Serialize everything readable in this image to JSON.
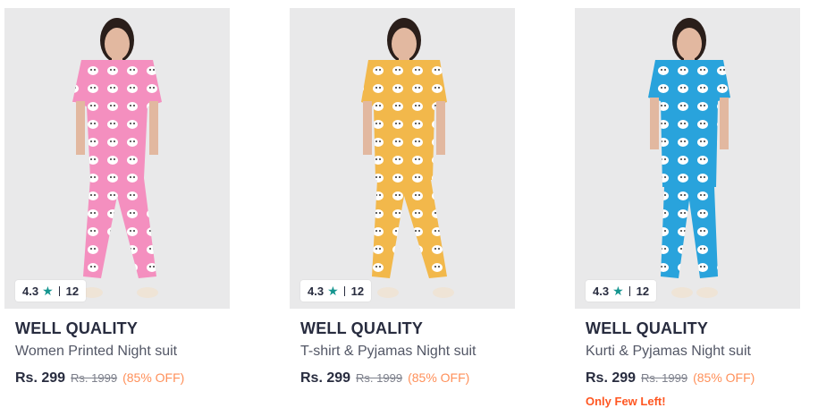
{
  "products": [
    {
      "rating": "4.3",
      "rating_count": "12",
      "brand": "WELL QUALITY",
      "title": "Women Printed Night suit",
      "price": "Rs. 299",
      "mrp": "Rs. 1999",
      "discount": "(85% OFF)",
      "stock_note": "",
      "color": "#f48fbf"
    },
    {
      "rating": "4.3",
      "rating_count": "12",
      "brand": "WELL QUALITY",
      "title": "T-shirt & Pyjamas Night suit",
      "price": "Rs. 299",
      "mrp": "Rs. 1999",
      "discount": "(85% OFF)",
      "stock_note": "",
      "color": "#f2b84b"
    },
    {
      "rating": "4.3",
      "rating_count": "12",
      "brand": "WELL QUALITY",
      "title": "Kurti & Pyjamas Night suit",
      "price": "Rs. 299",
      "mrp": "Rs. 1999",
      "discount": "(85% OFF)",
      "stock_note": "Only Few Left!",
      "color": "#29a3dc"
    }
  ],
  "icons": {
    "rating_star": "star-icon"
  },
  "colors": {
    "rating_star": "#14958f",
    "discount": "#ff905a",
    "stock_note": "#ff5722"
  }
}
